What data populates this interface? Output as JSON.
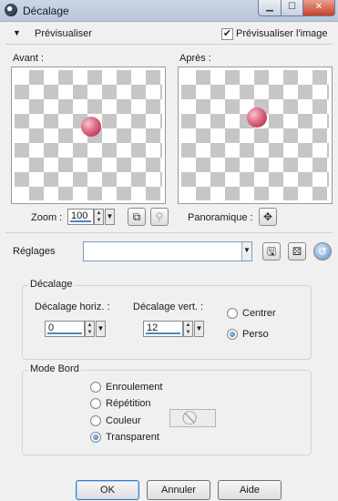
{
  "window": {
    "title": "Décalage"
  },
  "preview": {
    "toggle_icon": "triangle-down",
    "label": "Prévisualiser",
    "checkbox_label": "Prévisualiser l'image",
    "checked": true,
    "before_label": "Avant :",
    "after_label": "Après :"
  },
  "zoom": {
    "label": "Zoom :",
    "value": "100"
  },
  "pan": {
    "label": "Panoramique :"
  },
  "presets": {
    "label": "Réglages",
    "value": ""
  },
  "offset": {
    "group_title": "Décalage",
    "horizontal_label": "Décalage horiz. :",
    "horizontal_value": "0",
    "vertical_label": "Décalage vert. :",
    "vertical_value": "12",
    "mode_options": [
      {
        "label": "Centrer",
        "checked": false
      },
      {
        "label": "Perso",
        "checked": true
      }
    ]
  },
  "edge_mode": {
    "group_title": "Mode Bord",
    "options": [
      {
        "label": "Enroulement",
        "checked": false
      },
      {
        "label": "Répétition",
        "checked": false
      },
      {
        "label": "Couleur",
        "checked": false
      },
      {
        "label": "Transparent",
        "checked": true
      }
    ]
  },
  "buttons": {
    "ok": "OK",
    "cancel": "Annuler",
    "help": "Aide"
  },
  "colors": {
    "ball": "#d0506a",
    "accent": "#2c6cb8",
    "titlebar": "#c3d1e2"
  }
}
